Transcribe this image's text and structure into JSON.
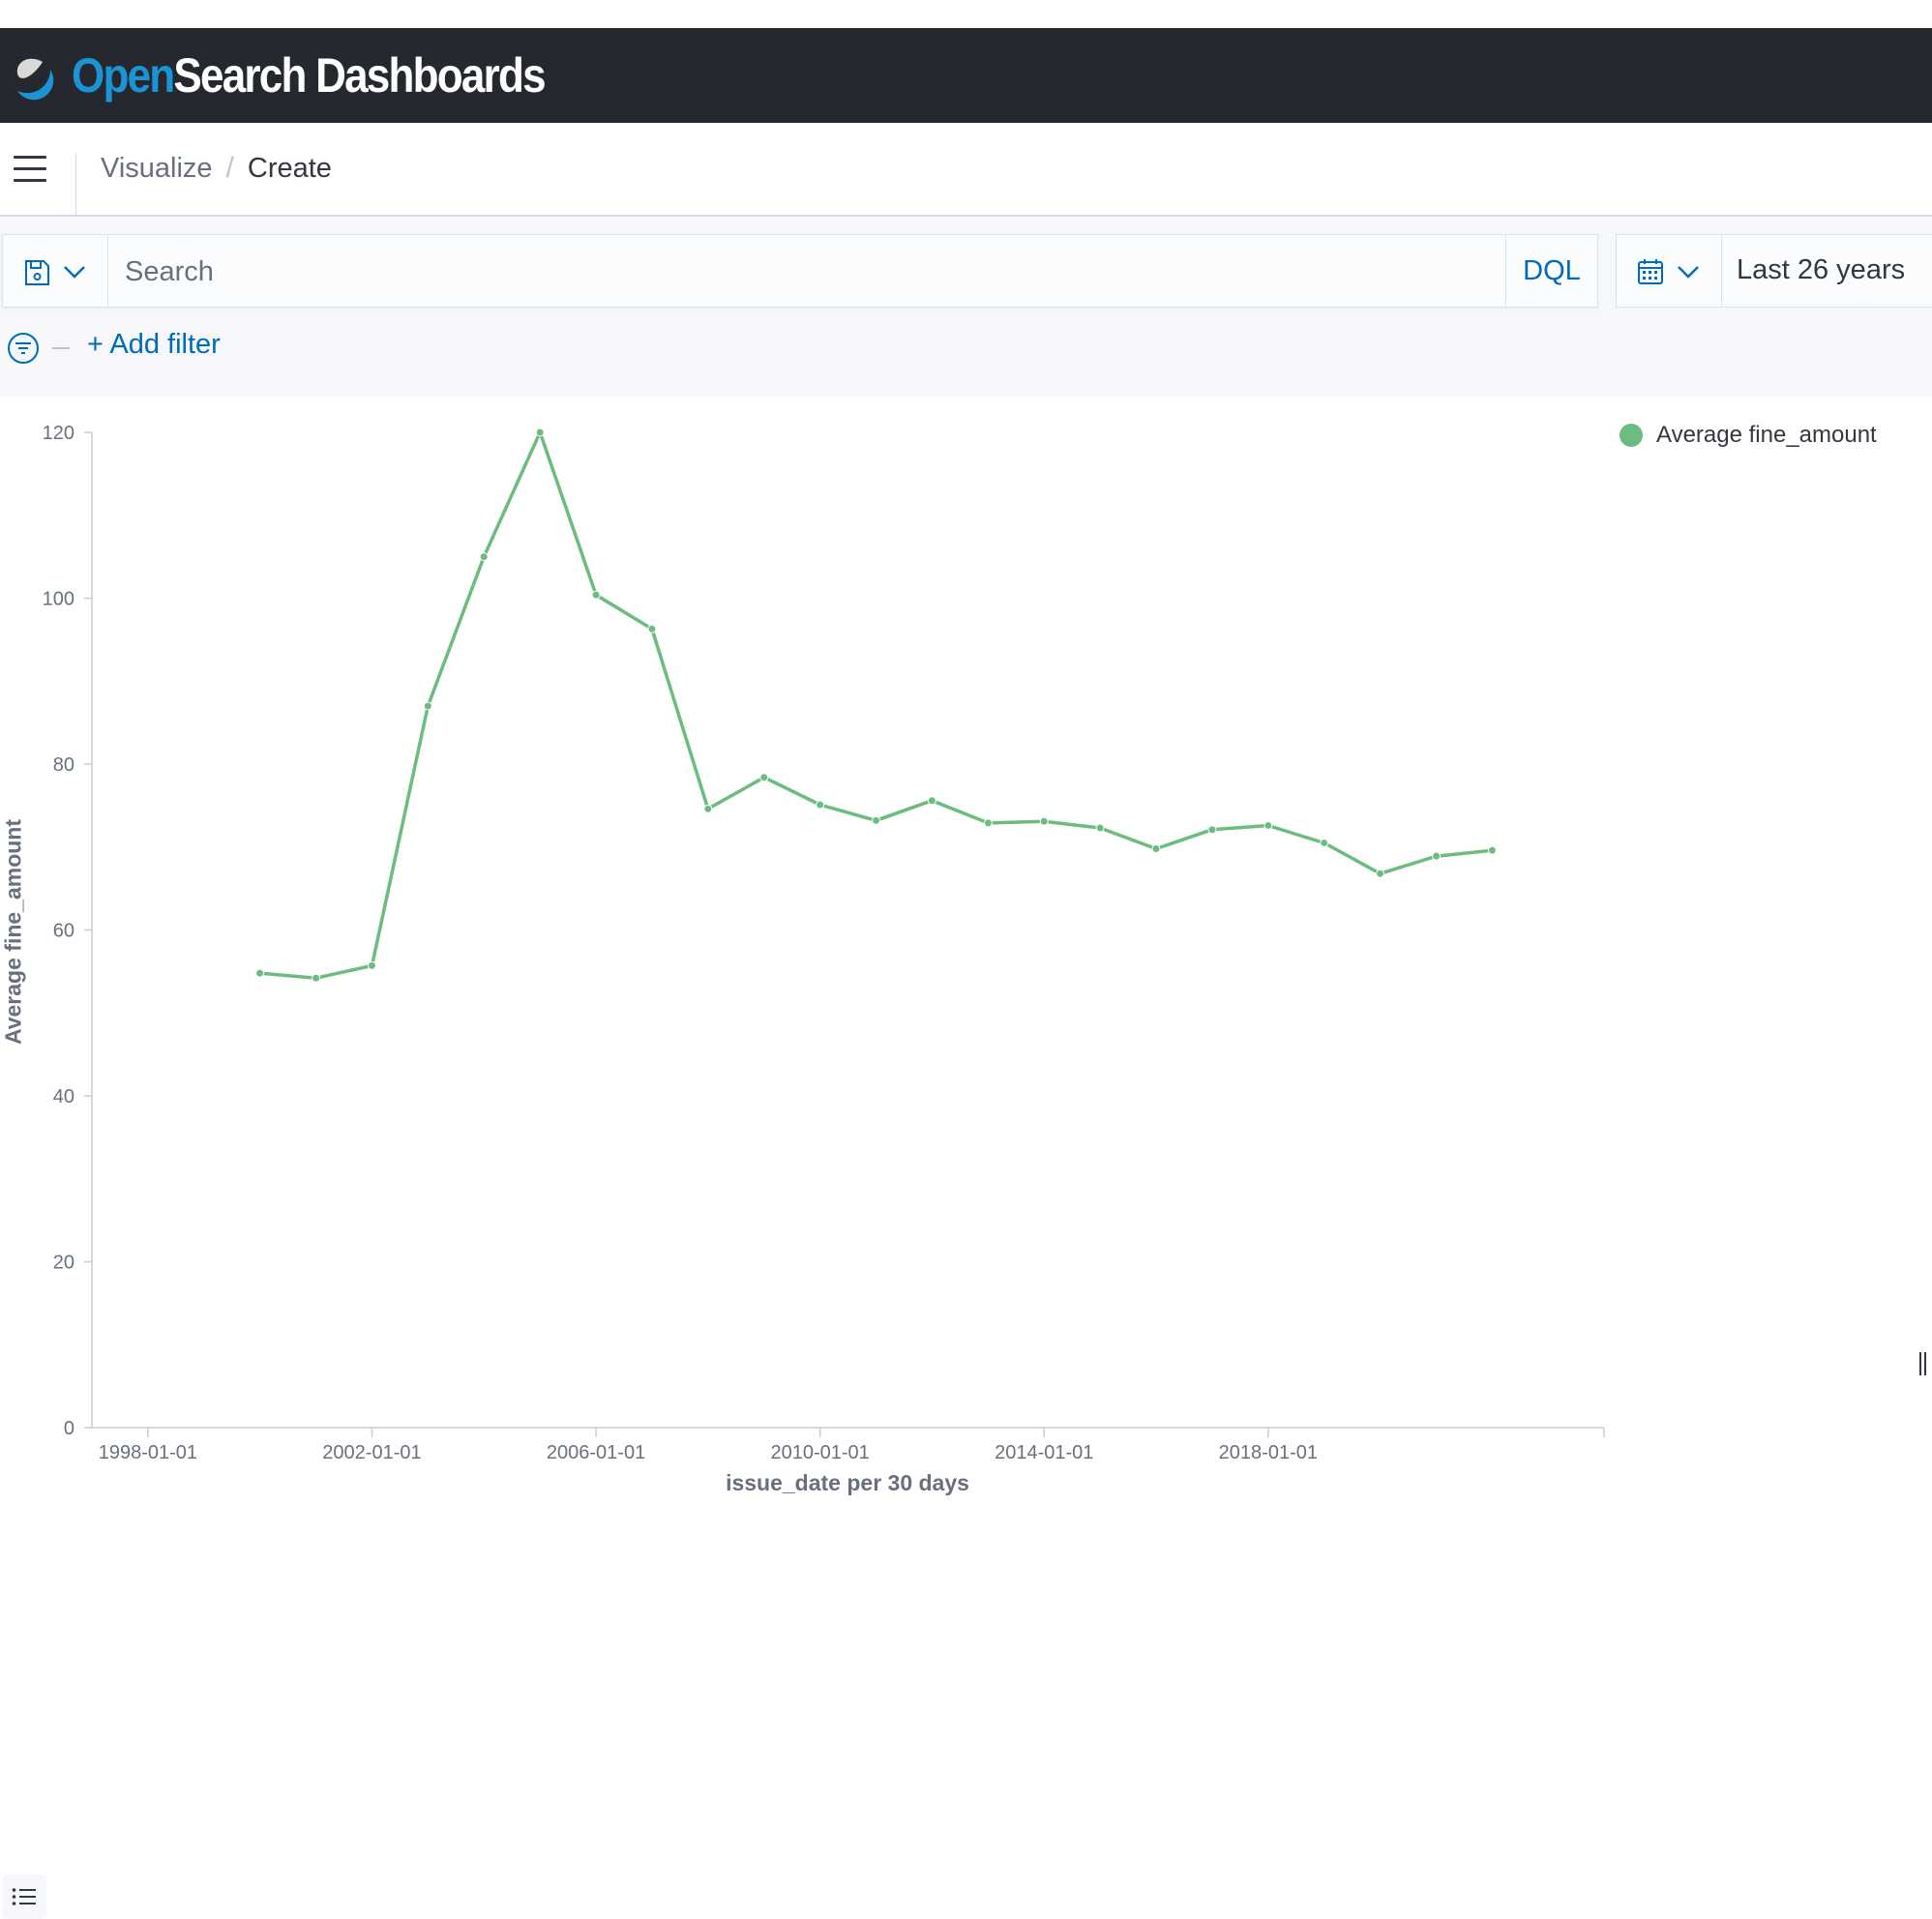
{
  "header": {
    "logo_open": "Open",
    "logo_rest": "Search Dashboards",
    "brand_color": "#1b94d6"
  },
  "nav": {
    "menu_icon": "hamburger-menu-icon",
    "breadcrumbs": [
      "Visualize",
      "Create"
    ]
  },
  "query": {
    "saved_icon": "save-icon",
    "search_placeholder": "Search",
    "language": "DQL",
    "date_icon": "calendar-icon",
    "time_range": "Last 26 years",
    "add_filter": "+ Add filter"
  },
  "chart_data": {
    "type": "line",
    "xlabel": "issue_date per 30 days",
    "ylabel": "Average fine_amount",
    "ylim": [
      0,
      120
    ],
    "yticks": [
      0,
      20,
      40,
      60,
      80,
      100,
      120
    ],
    "xlim": [
      "1997-01-01",
      "2023-12-31"
    ],
    "xticks": [
      "1998-01-01",
      "2002-01-01",
      "2006-01-01",
      "2010-01-01",
      "2014-01-01",
      "2018-01-01"
    ],
    "grid": false,
    "legend_position": "top-right",
    "series": [
      {
        "name": "Average fine_amount",
        "color": "#6dbc7f",
        "points": [
          {
            "x": "2000-01-01",
            "y": 54.8
          },
          {
            "x": "2001-01-01",
            "y": 54.2
          },
          {
            "x": "2002-01-01",
            "y": 55.7
          },
          {
            "x": "2003-01-01",
            "y": 87.0
          },
          {
            "x": "2004-01-01",
            "y": 105.0
          },
          {
            "x": "2005-01-01",
            "y": 120.0
          },
          {
            "x": "2006-01-01",
            "y": 100.4
          },
          {
            "x": "2007-01-01",
            "y": 96.3
          },
          {
            "x": "2008-01-01",
            "y": 74.6
          },
          {
            "x": "2009-01-01",
            "y": 78.4
          },
          {
            "x": "2010-01-01",
            "y": 75.1
          },
          {
            "x": "2011-01-01",
            "y": 73.2
          },
          {
            "x": "2012-01-01",
            "y": 75.6
          },
          {
            "x": "2013-01-01",
            "y": 72.9
          },
          {
            "x": "2014-01-01",
            "y": 73.1
          },
          {
            "x": "2015-01-01",
            "y": 72.3
          },
          {
            "x": "2016-01-01",
            "y": 69.8
          },
          {
            "x": "2017-01-01",
            "y": 72.1
          },
          {
            "x": "2018-01-01",
            "y": 72.6
          },
          {
            "x": "2019-01-01",
            "y": 70.5
          },
          {
            "x": "2020-01-01",
            "y": 66.8
          },
          {
            "x": "2021-01-01",
            "y": 68.9
          },
          {
            "x": "2022-01-01",
            "y": 69.6
          }
        ]
      }
    ]
  }
}
